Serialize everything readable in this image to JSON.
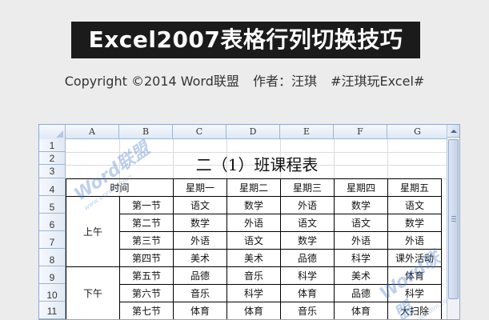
{
  "banner_title": "Excel2007表格行列切换技巧",
  "byline": {
    "copyright": "Copyright ©2014 Word联盟",
    "author": "作者：汪琪",
    "tag": "#汪琪玩Excel#"
  },
  "columns": [
    "A",
    "B",
    "C",
    "D",
    "E",
    "F",
    "G"
  ],
  "rows": [
    "1",
    "2",
    "3",
    "4",
    "5",
    "6",
    "7",
    "8",
    "9",
    "10",
    "11"
  ],
  "sheet_title": "二（1）班课程表",
  "table": {
    "header": {
      "time": "时间",
      "days": [
        "星期一",
        "星期二",
        "星期三",
        "星期四",
        "星期五"
      ]
    },
    "morning_label": "上午",
    "afternoon_label": "下午",
    "periods": [
      "第一节",
      "第二节",
      "第三节",
      "第四节",
      "第五节",
      "第六节",
      "第七节"
    ],
    "schedule": [
      [
        "语文",
        "数学",
        "外语",
        "数学",
        "语文"
      ],
      [
        "数学",
        "外语",
        "语文",
        "语文",
        "数学"
      ],
      [
        "外语",
        "语文",
        "数学",
        "外语",
        "外语"
      ],
      [
        "美术",
        "美术",
        "品德",
        "科学",
        "课外活动"
      ],
      [
        "品德",
        "音乐",
        "科学",
        "美术",
        "体育"
      ],
      [
        "音乐",
        "科学",
        "体育",
        "品德",
        "科学"
      ],
      [
        "体育",
        "体育",
        "音乐",
        "体育",
        "大扫除"
      ]
    ]
  },
  "watermark": {
    "brand": "Word联盟",
    "url": "www.wordlm.com"
  }
}
